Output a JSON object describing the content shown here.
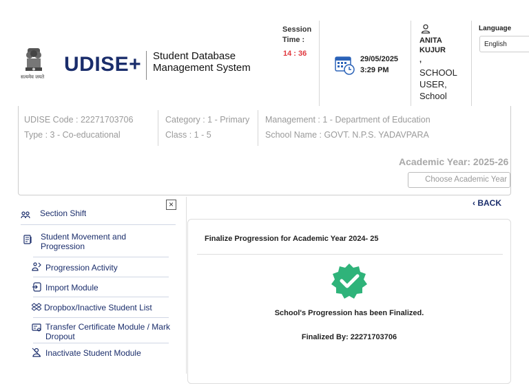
{
  "header": {
    "emblem_text": "सत्यमेव जयते",
    "brand": "UDISE+",
    "system_name_line1": "Student Database",
    "system_name_line2": "Management System",
    "session_label_line1": "Session",
    "session_label_line2": "Time :",
    "session_time": "14 : 36",
    "date": "29/05/2025",
    "time": "3:29 PM",
    "user_name_line1": "ANITA",
    "user_name_line2": "KUJUR",
    "user_role_comma": ",",
    "user_role_line1": "SCHOOL",
    "user_role_line2": "USER,",
    "user_role_line3": "School",
    "language_label": "Language",
    "language_value": "English"
  },
  "school_info": {
    "udise_code": "UDISE Code : 22271703706",
    "type": "Type : 3 - Co-educational",
    "category": "Category : 1 - Primary",
    "class": "Class : 1 - 5",
    "management": "Management : 1 - Department of Education",
    "school_name": "School Name : GOVT. N.P.S. YADAVPARA",
    "academic_year": "Academic Year: 2025-26",
    "choose_academic_year": "Choose Academic Year"
  },
  "sidebar": {
    "close_symbol": "×",
    "items": [
      {
        "label": "Section Shift",
        "icon": "section-shift-icon"
      },
      {
        "label_line1": "Student Movement and",
        "label_line2": "Progression",
        "icon": "student-movement-icon"
      },
      {
        "label": "Progression Activity",
        "icon": "progression-activity-icon"
      },
      {
        "label": "Import Module",
        "icon": "import-icon"
      },
      {
        "label": "Dropbox/Inactive Student List",
        "icon": "dropbox-icon"
      },
      {
        "label_line1": "Transfer Certificate Module / Mark",
        "label_line2": "Dropout",
        "icon": "transfer-certificate-icon"
      },
      {
        "label": "Inactivate Student Module",
        "icon": "inactivate-student-icon"
      }
    ]
  },
  "main": {
    "back_label": "BACK",
    "card_title": "Finalize Progression for Academic Year 2024- 25",
    "finalized_message": "School's Progression has been Finalized.",
    "finalized_by": "Finalized By: 22271703706"
  },
  "colors": {
    "brand_blue": "#1a2d6b",
    "session_red": "#e0383e",
    "success_green": "#2fb37a"
  }
}
